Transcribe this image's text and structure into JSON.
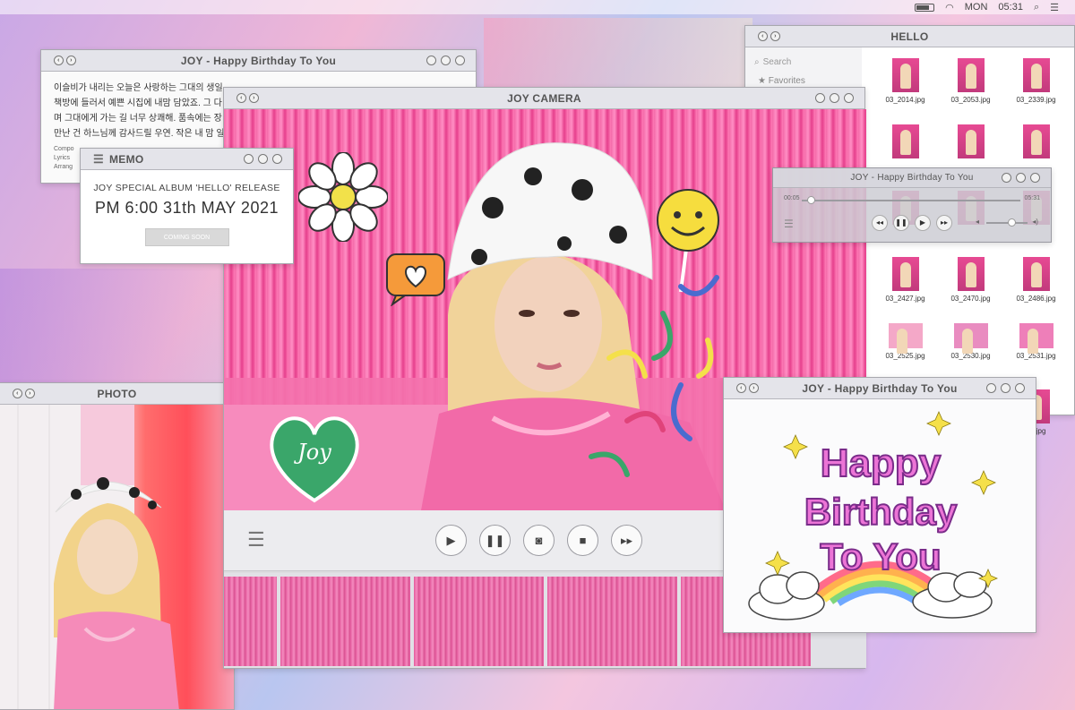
{
  "menubar": {
    "day": "MON",
    "time": "05:31"
  },
  "lyrics_window": {
    "title": "JOY - Happy Birthday To You",
    "lines": [
      "이슬비가 내리는 오늘은 사랑하는 그대의 생일",
      "책방에 들러서 예쁜 시집에 내맘 담았죠. 그 다",
      "며 그대에게 가는 길 너무 상쾌해. 품속에는 장",
      "만난 건 하느님께 감사드릴 우연. 작은 내 맘 일"
    ],
    "credits": [
      "Compo",
      "Lyrics",
      "Arrang"
    ]
  },
  "memo_window": {
    "label": "MEMO",
    "line1": "JOY SPECIAL ALBUM 'HELLO' RELEASE",
    "line2": "PM 6:00 31th MAY 2021",
    "button": "COMING SOON"
  },
  "photo_window": {
    "title": "PHOTO"
  },
  "hello_window": {
    "title": "HELLO",
    "search_placeholder": "Search",
    "favorites_label": "Favorites",
    "files": [
      "03_2014.jpg",
      "03_2053.jpg",
      "03_2339.jpg",
      "",
      "",
      "",
      "",
      "",
      "",
      "03_2427.jpg",
      "03_2470.jpg",
      "03_2486.jpg",
      "03_2525.jpg",
      "03_2530.jpg",
      "03_2531.jpg",
      "",
      "",
      "34.jpg"
    ]
  },
  "music_window": {
    "title": "JOY - Happy Birthday To You",
    "elapsed": "00:05",
    "remaining": "05:31",
    "progress": 0.04,
    "volume": 0.6
  },
  "camera_window": {
    "title": "JOY CAMERA",
    "heart_text": "Joy"
  },
  "bday_window": {
    "title": "JOY - Happy Birthday To You",
    "card_lines": [
      "Happy",
      "Birthday",
      "To You"
    ]
  },
  "colors": {
    "pink": "#ff5aa8",
    "accent_pink": "#e958c4",
    "chrome": "#e4e4ea"
  }
}
